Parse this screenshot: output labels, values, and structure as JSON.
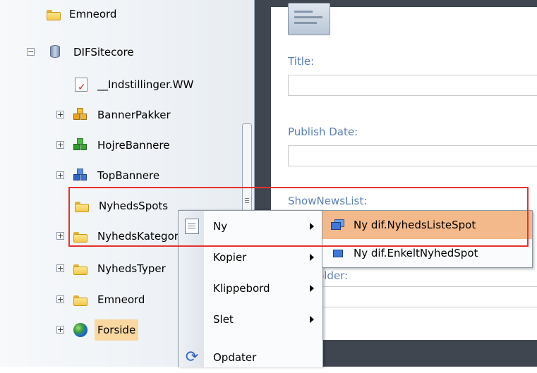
{
  "tree": {
    "items": [
      {
        "label": "Emneord",
        "icon": "folder-icon",
        "expander": ""
      },
      {
        "label": "DIFSitecore",
        "icon": "database-icon",
        "expander": "−"
      },
      {
        "label": "__Indstillinger.WW",
        "icon": "settings-document-icon",
        "expander": ""
      },
      {
        "label": "BannerPakker",
        "icon": "cubes-yellow-icon",
        "expander": "+"
      },
      {
        "label": "HojreBannere",
        "icon": "cubes-green-icon",
        "expander": "+"
      },
      {
        "label": "TopBannere",
        "icon": "cubes-blue-icon",
        "expander": "+"
      },
      {
        "label": "NyhedsSpots",
        "icon": "folder-icon",
        "expander": ""
      },
      {
        "label": "NyhedsKategorier",
        "icon": "folder-icon",
        "expander": "+"
      },
      {
        "label": "NyhedsTyper",
        "icon": "folder-icon",
        "expander": "+"
      },
      {
        "label": "Emneord",
        "icon": "folder-icon",
        "expander": "+"
      },
      {
        "label": "Forside",
        "icon": "globe-icon",
        "expander": "+"
      }
    ]
  },
  "editor": {
    "fields": [
      {
        "label": "Title:"
      },
      {
        "label": "Publish Date:"
      },
      {
        "label": "ShowNewsList:"
      },
      {
        "label": "RootFolder:"
      }
    ]
  },
  "context_menu": {
    "items": [
      {
        "label": "Ny",
        "icon": "new-page-icon",
        "submenu": true
      },
      {
        "label": "Kopier",
        "icon": "",
        "submenu": true
      },
      {
        "label": "Klippebord",
        "icon": "",
        "submenu": true
      },
      {
        "label": "Slet",
        "icon": "",
        "submenu": true
      },
      {
        "label": "Opdater",
        "icon": "refresh-icon",
        "submenu": false
      }
    ]
  },
  "submenu": {
    "items": [
      {
        "label": "Ny dif.NyhedsListeSpot",
        "icon": "windows-icon",
        "active": true
      },
      {
        "label": "Ny dif.EnkeltNyhedSpot",
        "icon": "window-icon",
        "active": false
      }
    ]
  },
  "colors": {
    "annotation": "#e8302c",
    "menu_highlight": "#f4b98a",
    "field_label": "#5a7fb8"
  }
}
